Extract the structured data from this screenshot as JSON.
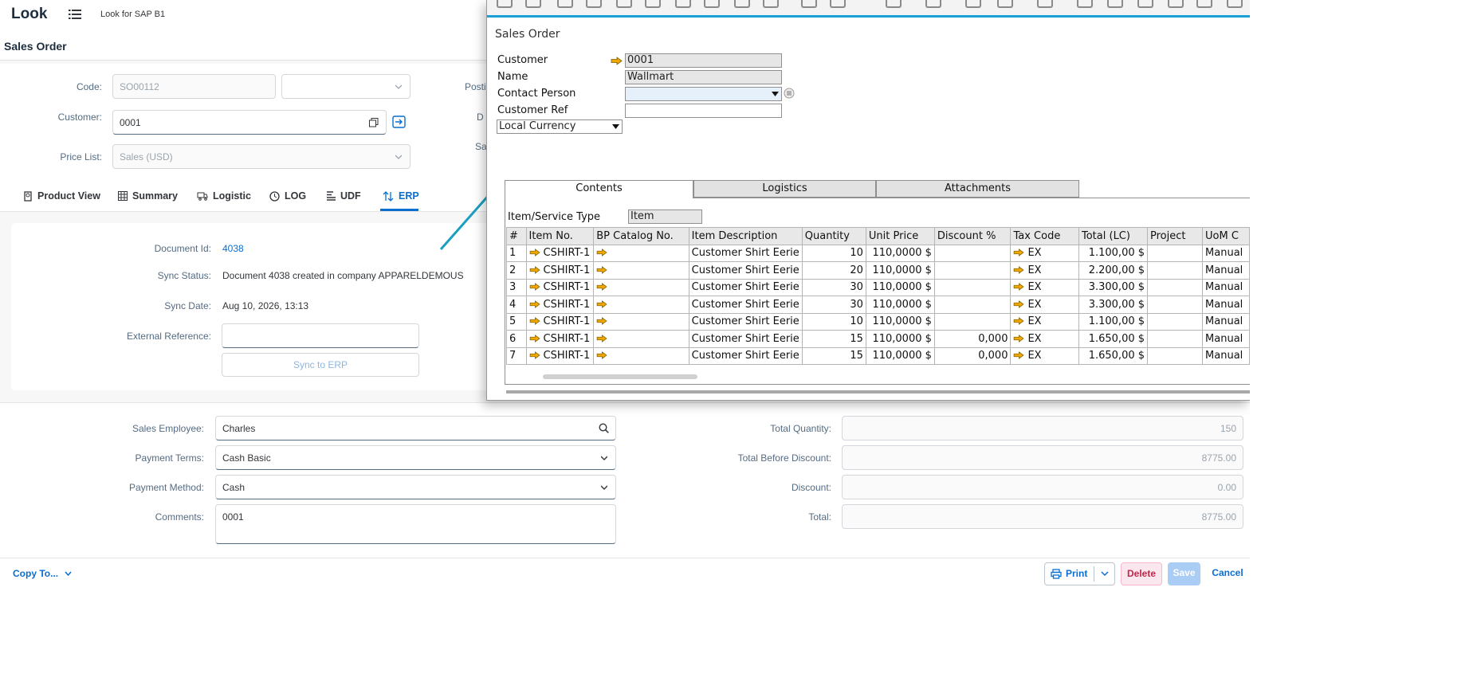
{
  "app": {
    "logo": "Look",
    "title": "Look for SAP B1",
    "page_title": "Sales Order"
  },
  "header_form": {
    "code_label": "Code:",
    "code_value": "SO00112",
    "customer_label": "Customer:",
    "customer_value": "0001",
    "price_list_label": "Price List:",
    "price_list_value": "Sales (USD)",
    "cut_label_1": "Postir",
    "cut_label_2": "D",
    "cut_label_3": "Sa"
  },
  "tabs": [
    {
      "label": "Product View",
      "icon": "product-view-icon"
    },
    {
      "label": "Summary",
      "icon": "table-icon"
    },
    {
      "label": "Logistic",
      "icon": "truck-icon"
    },
    {
      "label": "LOG",
      "icon": "log-icon"
    },
    {
      "label": "UDF",
      "icon": "udf-icon"
    },
    {
      "label": "ERP",
      "icon": "sort-arrows-icon",
      "selected": true
    }
  ],
  "erp": {
    "doc_id_label": "Document Id:",
    "doc_id": "4038",
    "sync_status_label": "Sync Status:",
    "sync_status": "Document 4038 created in company APPARELDEMOUS",
    "sync_date_label": "Sync Date:",
    "sync_date": "Aug 10, 2026, 13:13",
    "ext_ref_label": "External Reference:",
    "ext_ref": "",
    "sync_button": "Sync to ERP"
  },
  "lower": {
    "sales_employee_label": "Sales Employee:",
    "sales_employee": "Charles",
    "payment_terms_label": "Payment Terms:",
    "payment_terms": "Cash Basic",
    "payment_method_label": "Payment Method:",
    "payment_method": "Cash",
    "comments_label": "Comments:",
    "comments": "0001",
    "total_qty_label": "Total Quantity:",
    "total_qty": "150",
    "total_before_label": "Total Before Discount:",
    "total_before": "8775.00",
    "discount_label": "Discount:",
    "discount": "0.00",
    "total_label": "Total:",
    "total": "8775.00"
  },
  "footer": {
    "copy_to": "Copy To...",
    "print": "Print",
    "delete": "Delete",
    "save": "Save",
    "cancel": "Cancel"
  },
  "sap": {
    "title": "Sales Order",
    "customer_label": "Customer",
    "customer": "0001",
    "name_label": "Name",
    "name": "Wallmart",
    "contact_label": "Contact Person",
    "contact": "",
    "ref_label": "Customer Ref",
    "ref": "",
    "currency": "Local Currency",
    "tabs": [
      "Contents",
      "Logistics",
      "Attachments"
    ],
    "item_type_label": "Item/Service Type",
    "item_type": "Item",
    "columns": [
      "#",
      "Item No.",
      "BP Catalog No.",
      "Item Description",
      "Quantity",
      "Unit Price",
      "Discount %",
      "Tax Code",
      "Total (LC)",
      "Project",
      "UoM C"
    ],
    "rows": [
      [
        "1",
        "CSHIRT-1",
        "",
        "Customer Shirt Eerie",
        "10",
        "110,0000 $",
        "",
        "EX",
        "1.100,00 $",
        "",
        "Manual"
      ],
      [
        "2",
        "CSHIRT-1",
        "",
        "Customer Shirt Eerie",
        "20",
        "110,0000 $",
        "",
        "EX",
        "2.200,00 $",
        "",
        "Manual"
      ],
      [
        "3",
        "CSHIRT-1",
        "",
        "Customer Shirt Eerie",
        "30",
        "110,0000 $",
        "",
        "EX",
        "3.300,00 $",
        "",
        "Manual"
      ],
      [
        "4",
        "CSHIRT-1",
        "",
        "Customer Shirt Eerie",
        "30",
        "110,0000 $",
        "",
        "EX",
        "3.300,00 $",
        "",
        "Manual"
      ],
      [
        "5",
        "CSHIRT-1",
        "",
        "Customer Shirt Eerie",
        "10",
        "110,0000 $",
        "",
        "EX",
        "1.100,00 $",
        "",
        "Manual"
      ],
      [
        "6",
        "CSHIRT-1",
        "",
        "Customer Shirt Eerie",
        "15",
        "110,0000 $",
        "0,000",
        "EX",
        "1.650,00 $",
        "",
        "Manual"
      ],
      [
        "7",
        "CSHIRT-1",
        "",
        "Customer Shirt Eerie",
        "15",
        "110,0000 $",
        "0,000",
        "EX",
        "1.650,00 $",
        "",
        "Manual"
      ]
    ]
  },
  "colors": {
    "accent": "#0a6ed1",
    "arrow_annotation": "#1a9fc0",
    "sap_link_arrow": "#f0a800",
    "delete_bg": "#fde7ef",
    "save_bg": "#a9cdf4"
  }
}
